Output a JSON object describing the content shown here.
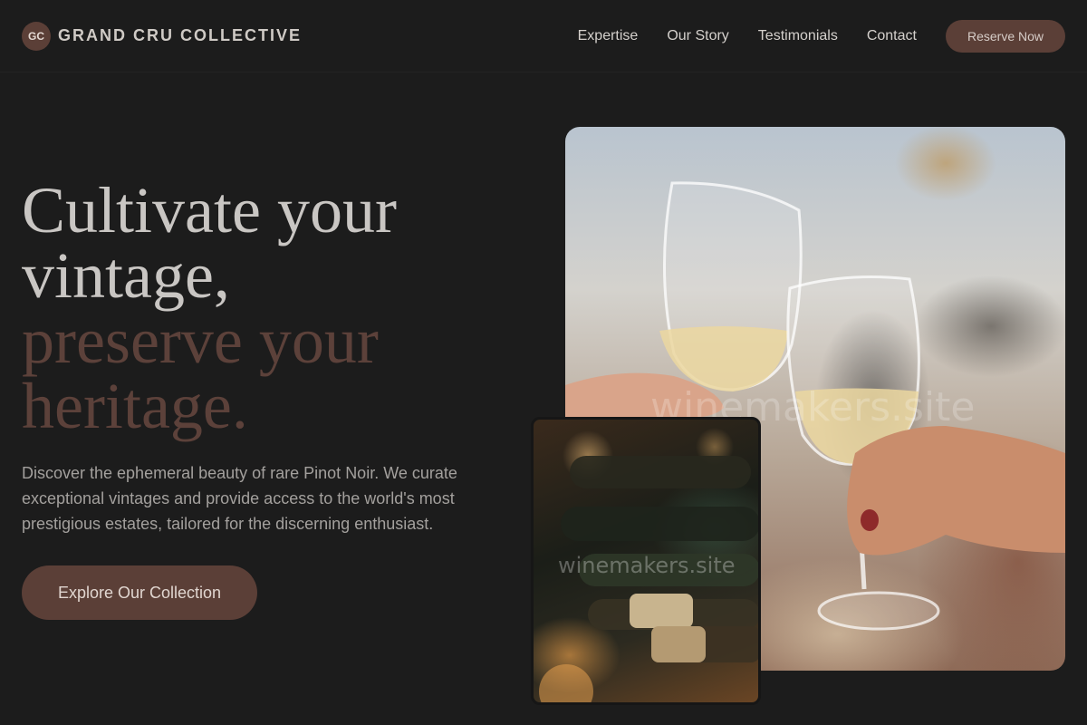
{
  "brand": {
    "logo_initials": "GC",
    "name": "GRAND CRU COLLECTIVE"
  },
  "nav": {
    "links": [
      "Expertise",
      "Our Story",
      "Testimonials",
      "Contact"
    ],
    "cta": "Reserve Now"
  },
  "hero": {
    "title_line1": "Cultivate your",
    "title_line2": "vintage,",
    "title_accent_line1": "preserve your",
    "title_accent_line2": "heritage.",
    "description": "Discover the ephemeral beauty of rare Pinot Noir. We curate exceptional vintages and provide access to the world's most prestigious estates, tailored for the discerning enthusiast.",
    "cta": "Explore Our Collection"
  },
  "images": {
    "main_watermark": "winemakers.site",
    "secondary_watermark": "winemakers.site"
  },
  "colors": {
    "background": "#1c1c1c",
    "accent": "#5b3f37",
    "text_primary": "#c9c6c3",
    "text_muted": "#a3a09d"
  },
  "icons": {
    "logo": "gc-monogram-badge"
  }
}
